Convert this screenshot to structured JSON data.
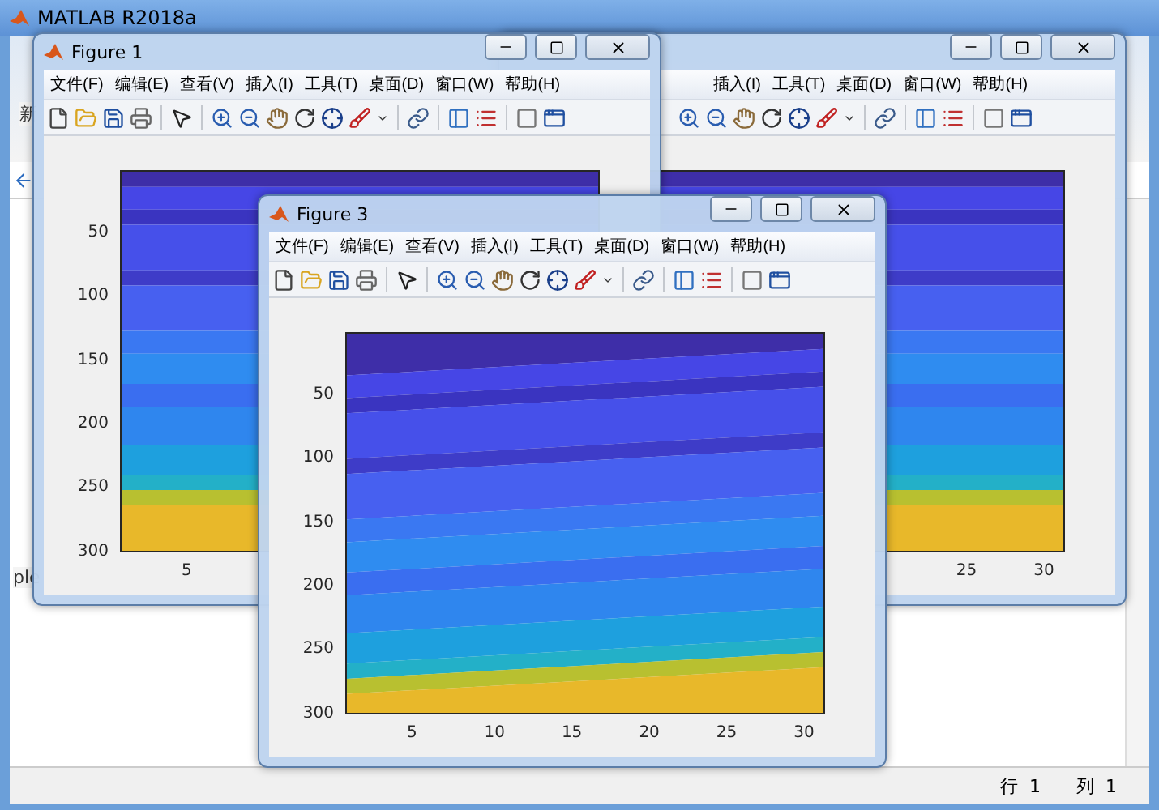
{
  "main_window": {
    "title": "MATLAB R2018a",
    "ribbon_text": "新",
    "panel_text": "ple",
    "status_bar": [
      {
        "label": "行",
        "value": "1"
      },
      {
        "label": "列",
        "value": "1"
      }
    ]
  },
  "figures": [
    {
      "title": "Figure 1",
      "menu": [
        "文件(F)",
        "编辑(E)",
        "查看(V)",
        "插入(I)",
        "工具(T)",
        "桌面(D)",
        "窗口(W)",
        "帮助(H)"
      ],
      "y_ticks": [
        "50",
        "100",
        "150",
        "200",
        "250",
        "300"
      ],
      "x_ticks": [
        "5"
      ]
    },
    {
      "menu": [
        "插入(I)",
        "工具(T)",
        "桌面(D)",
        "窗口(W)",
        "帮助(H)"
      ],
      "x_ticks": [
        "25",
        "30"
      ]
    },
    {
      "title": "Figure 3",
      "menu": [
        "文件(F)",
        "编辑(E)",
        "查看(V)",
        "插入(I)",
        "工具(T)",
        "桌面(D)",
        "窗口(W)",
        "帮助(H)"
      ],
      "y_ticks": [
        "50",
        "100",
        "150",
        "200",
        "250",
        "300"
      ],
      "x_ticks": [
        "5",
        "10",
        "15",
        "20",
        "25",
        "30"
      ]
    }
  ]
}
